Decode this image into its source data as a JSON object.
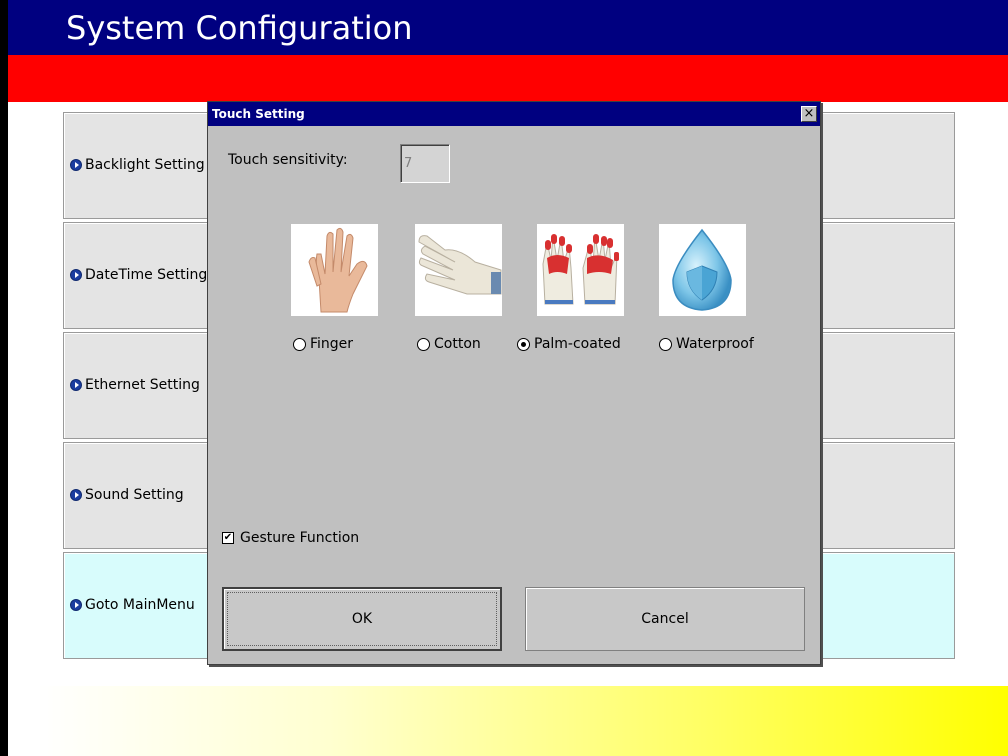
{
  "header": {
    "title": "System Configuration"
  },
  "menu": {
    "items": [
      {
        "label": "Backlight Setting"
      },
      {
        "label": "DateTime Setting"
      },
      {
        "label": "Ethernet Setting"
      },
      {
        "label": "Sound Setting"
      },
      {
        "label": "Goto MainMenu"
      }
    ]
  },
  "dialog": {
    "title": "Touch Setting",
    "close": "×",
    "sensitivity_label": "Touch sensitivity:",
    "sensitivity_value": "7",
    "options": [
      {
        "label": "Finger",
        "icon": "hand-icon",
        "selected": false
      },
      {
        "label": "Cotton",
        "icon": "cotton-glove-icon",
        "selected": false
      },
      {
        "label": "Palm-coated",
        "icon": "coated-gloves-icon",
        "selected": true
      },
      {
        "label": "Waterproof",
        "icon": "water-drop-shield-icon",
        "selected": false
      }
    ],
    "gesture_label": "Gesture Function",
    "gesture_checked": true,
    "ok_label": "OK",
    "cancel_label": "Cancel"
  },
  "colors": {
    "title_bar": "#000080",
    "red_bar": "#ff0000",
    "dialog_bg": "#c0c0c0",
    "menu_highlight": "#d8fcfc"
  }
}
